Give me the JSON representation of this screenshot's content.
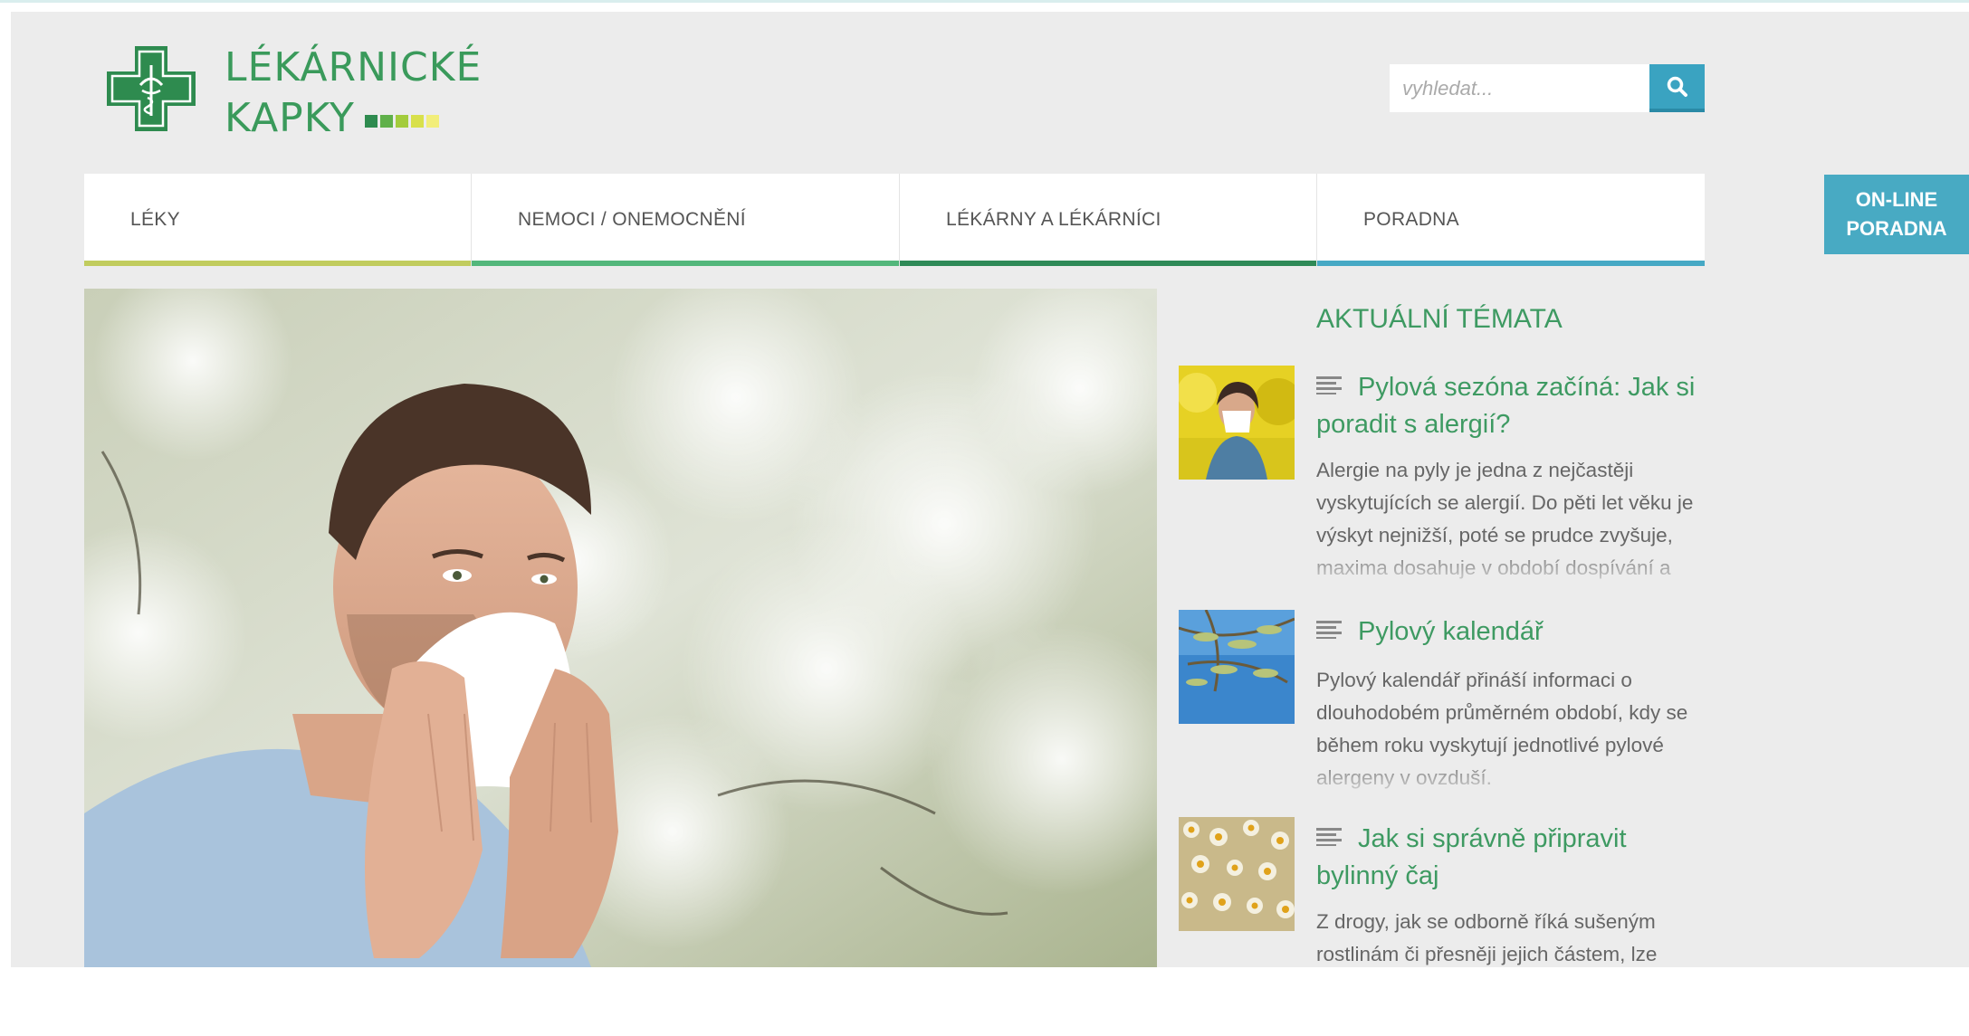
{
  "brand": {
    "line1": "LÉKÁRNICKÉ",
    "line2": "KAPKY",
    "colors": [
      "#2e8b4f",
      "#5fb04a",
      "#a3cc3c",
      "#d8e04a",
      "#f2ee7a"
    ]
  },
  "search": {
    "placeholder": "vyhledat...",
    "icon": "search-icon"
  },
  "nav": {
    "items": [
      {
        "label": "LÉKY"
      },
      {
        "label": "NEMOCI / ONEMOCNĚNÍ"
      },
      {
        "label": "LÉKÁRNY A LÉKÁRNÍCI"
      },
      {
        "label": "PORADNA"
      }
    ]
  },
  "online": {
    "line1": "ON-LINE",
    "line2": "PORADNA"
  },
  "topics": {
    "heading": "AKTUÁLNÍ TÉMATA",
    "articles": [
      {
        "title": "Pylová sezóna začíná: Jak si poradit s alergií?",
        "excerpt": "Alergie na pyly je jedna z nejčastěji vyskytujících se alergií. Do pěti let věku je výskyt nejnižší, poté se prudce zvyšuje, maxima dosahuje v období dospívání a"
      },
      {
        "title": "Pylový kalendář",
        "excerpt": "Pylový kalendář přináší informaci o dlouhodobém průměrném období, kdy se během roku vyskytují jednotlivé pylové alergeny v ovzduší."
      },
      {
        "title": "Jak si správně připravit bylinný čaj",
        "excerpt": "Z drogy, jak se odborně říká sušeným rostlinám či přesněji jejich částem, lze"
      }
    ]
  },
  "theme": {
    "green": "#3e9a62",
    "blue": "#48aac3",
    "background": "#ececec"
  }
}
